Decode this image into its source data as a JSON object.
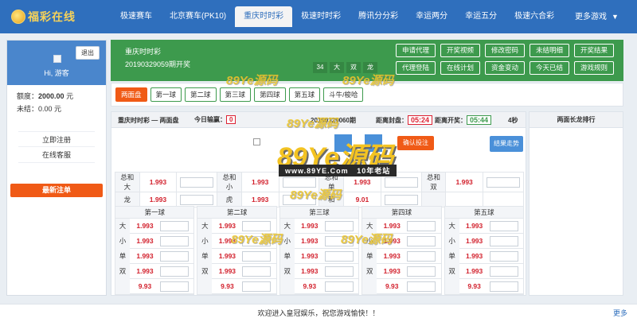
{
  "brand": {
    "name": "福彩在线"
  },
  "nav": {
    "items": [
      "极速赛车",
      "北京赛车(PK10)",
      "重庆时时彩",
      "极速时时彩",
      "腾讯分分彩",
      "幸运两分",
      "幸运五分",
      "极速六合彩"
    ],
    "more": "更多游戏"
  },
  "sidebar": {
    "logout": "退出",
    "greeting": "Hi, 游客",
    "balance_label": "额度：",
    "balance_value": "2000.00",
    "balance_unit": "元",
    "unsettled_label": "未结：",
    "unsettled_value": "0.00 元",
    "links": [
      "立即注册",
      "在线客服"
    ],
    "latest": "最新注单"
  },
  "game": {
    "name": "重庆时时彩",
    "issue": "20190329059期开奖",
    "badges": [
      "34",
      "大",
      "双",
      "龙"
    ],
    "buttons": [
      "申请代理",
      "开奖视频",
      "修改密码",
      "未结明细",
      "开奖结果",
      "代理登陆",
      "在线计划",
      "资金变动",
      "今天已结",
      "游戏规则"
    ]
  },
  "tabs": [
    "两面盘",
    "第一球",
    "第二球",
    "第三球",
    "第四球",
    "第五球",
    "斗牛/梭哈"
  ],
  "panel": {
    "title": "重庆时时彩 — 两面盘",
    "today_label": "今日输赢：",
    "today_value": "0",
    "issue_text": "20190329060期",
    "close_label": "距离封盘：",
    "close_time": "05:24",
    "open_label": "距离开奖：",
    "open_time": "05:44",
    "seconds": "4秒",
    "confirm": "确认投注",
    "trend": "结果走势"
  },
  "summary_rows": [
    [
      {
        "label": "总和大",
        "odds": "1.993"
      },
      {
        "label": "总和小",
        "odds": "1.993"
      },
      {
        "label": "总和单",
        "odds": "1.993"
      },
      {
        "label": "总和双",
        "odds": "1.993"
      }
    ],
    [
      {
        "label": "龙",
        "odds": "1.993"
      },
      {
        "label": "虎",
        "odds": "1.993"
      },
      {
        "label": "和",
        "odds": "9.01"
      }
    ]
  ],
  "ball_columns": [
    {
      "title": "第一球",
      "rows": [
        {
          "label": "大",
          "odds": "1.993"
        },
        {
          "label": "小",
          "odds": "1.993"
        },
        {
          "label": "单",
          "odds": "1.993"
        },
        {
          "label": "双",
          "odds": "1.993"
        },
        {
          "label": "",
          "odds": "9.93"
        }
      ]
    },
    {
      "title": "第二球",
      "rows": [
        {
          "label": "大",
          "odds": "1.993"
        },
        {
          "label": "小",
          "odds": "1.993"
        },
        {
          "label": "单",
          "odds": "1.993"
        },
        {
          "label": "双",
          "odds": "1.993"
        },
        {
          "label": "",
          "odds": "9.93"
        }
      ]
    },
    {
      "title": "第三球",
      "rows": [
        {
          "label": "大",
          "odds": "1.993"
        },
        {
          "label": "小",
          "odds": "1.993"
        },
        {
          "label": "单",
          "odds": "1.993"
        },
        {
          "label": "双",
          "odds": "1.993"
        },
        {
          "label": "",
          "odds": "9.93"
        }
      ]
    },
    {
      "title": "第四球",
      "rows": [
        {
          "label": "大",
          "odds": "1.993"
        },
        {
          "label": "小",
          "odds": "1.993"
        },
        {
          "label": "单",
          "odds": "1.993"
        },
        {
          "label": "双",
          "odds": "1.993"
        },
        {
          "label": "",
          "odds": "9.93"
        }
      ]
    },
    {
      "title": "第五球",
      "rows": [
        {
          "label": "大",
          "odds": "1.993"
        },
        {
          "label": "小",
          "odds": "1.993"
        },
        {
          "label": "单",
          "odds": "1.993"
        },
        {
          "label": "双",
          "odds": "1.993"
        },
        {
          "label": "",
          "odds": "9.93"
        }
      ]
    }
  ],
  "right_panel": {
    "title": "两面长龙排行"
  },
  "footer": {
    "message": "欢迎进入皇冠娱乐，祝您游戏愉快！！",
    "more": "更多"
  },
  "watermark": {
    "brand": "89Ye源码",
    "url": "www.89YE.Com",
    "slogan": "10年老站"
  }
}
